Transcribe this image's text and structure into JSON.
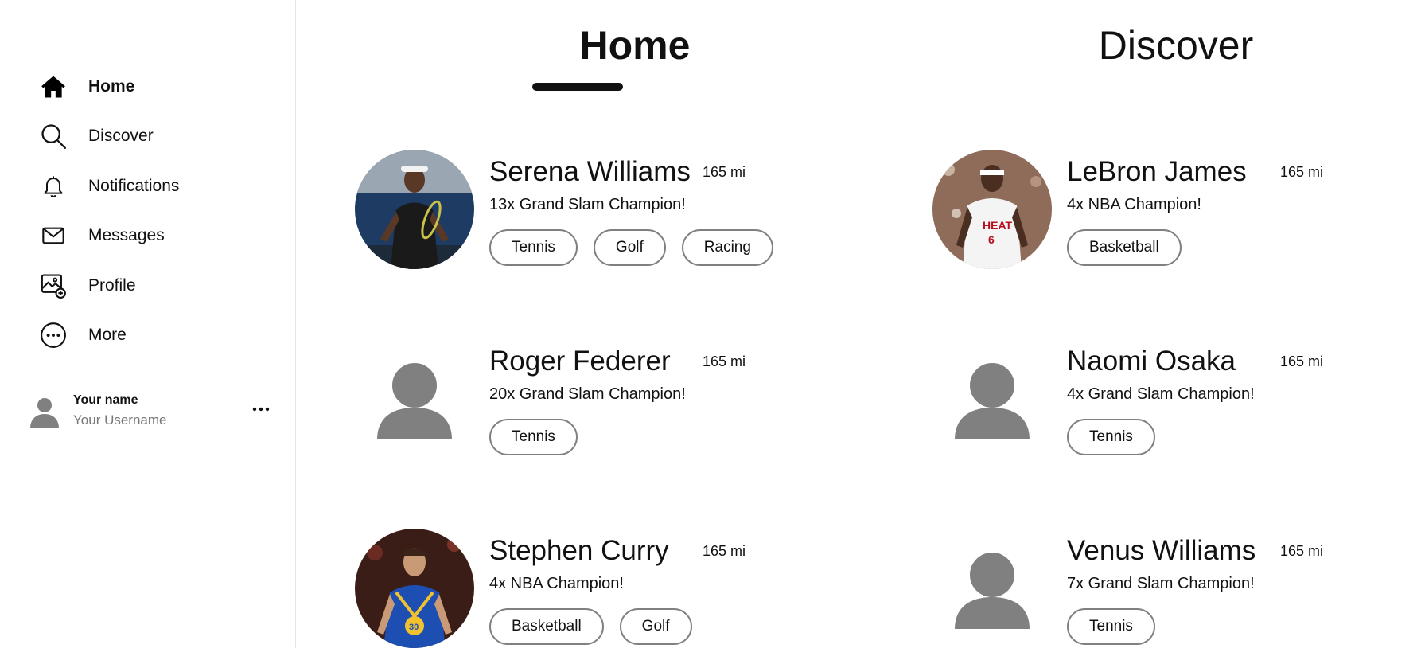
{
  "sidebar": {
    "items": [
      {
        "label": "Home",
        "icon": "home-icon"
      },
      {
        "label": "Discover",
        "icon": "search-icon"
      },
      {
        "label": "Notifications",
        "icon": "bell-icon"
      },
      {
        "label": "Messages",
        "icon": "mail-icon"
      },
      {
        "label": "Profile",
        "icon": "profile-image-icon"
      },
      {
        "label": "More",
        "icon": "more-circle-icon"
      }
    ],
    "user": {
      "name": "Your name",
      "username": "Your Username"
    }
  },
  "tabs": {
    "home": "Home",
    "discover": "Discover",
    "active": "Home"
  },
  "athletes": [
    {
      "name": "Serena Williams",
      "distance": "165 mi",
      "description": "13x Grand Slam Champion!",
      "tags": [
        "Tennis",
        "Golf",
        "Racing"
      ],
      "avatar": "photo"
    },
    {
      "name": "LeBron James",
      "distance": "165 mi",
      "description": "4x NBA Champion!",
      "tags": [
        "Basketball"
      ],
      "avatar": "photo"
    },
    {
      "name": "Roger Federer",
      "distance": "165 mi",
      "description": "20x Grand Slam Champion!",
      "tags": [
        "Tennis"
      ],
      "avatar": "placeholder"
    },
    {
      "name": "Naomi Osaka",
      "distance": "165 mi",
      "description": "4x Grand Slam Champion!",
      "tags": [
        "Tennis"
      ],
      "avatar": "placeholder"
    },
    {
      "name": "Stephen Curry",
      "distance": "165 mi",
      "description": "4x NBA Champion!",
      "tags": [
        "Basketball",
        "Golf"
      ],
      "avatar": "photo"
    },
    {
      "name": "Venus Williams",
      "distance": "165 mi",
      "description": "7x Grand Slam Champion!",
      "tags": [
        "Tennis"
      ],
      "avatar": "placeholder"
    }
  ],
  "colors": {
    "text": "#111111",
    "muted": "#777777",
    "placeholder_avatar": "#808080",
    "tag_border": "#808080",
    "divider": "#e3e3e3"
  }
}
